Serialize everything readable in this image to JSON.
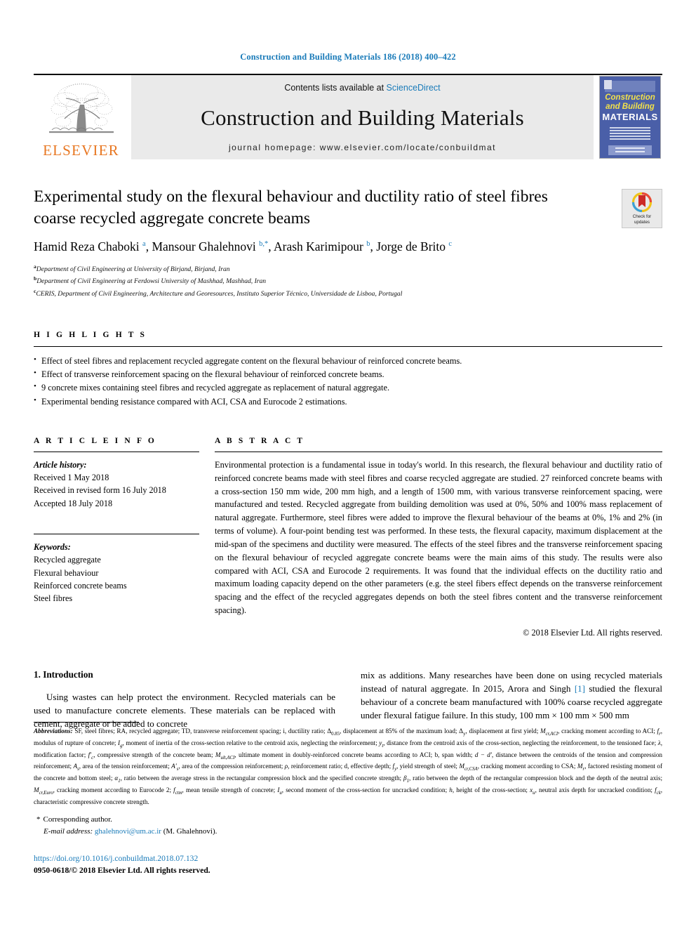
{
  "running_head": "Construction and Building Materials 186 (2018) 400–422",
  "masthead": {
    "publisher": "ELSEVIER",
    "contents_prefix": "Contents lists available at ",
    "sciencedirect": "ScienceDirect",
    "journal_title": "Construction and Building Materials",
    "homepage": "journal homepage: www.elsevier.com/locate/conbuildmat",
    "cover": {
      "line1": "Construction",
      "line2": "and Building",
      "line3": "MATERIALS"
    }
  },
  "article": {
    "title": "Experimental study on the flexural behaviour and ductility ratio of steel fibres coarse recycled aggregate concrete beams",
    "authors_html": "Hamid Reza Chaboki <sup>a</sup>, Mansour Ghalehnovi <sup>b,</sup><sup class=\"star\">*</sup>, Arash Karimipour <sup>b</sup>, Jorge de Brito <sup>c</sup>",
    "affiliations": [
      {
        "marker": "a",
        "text": "Department of Civil Engineering at University of Birjand, Birjand, Iran"
      },
      {
        "marker": "b",
        "text": "Department of Civil Engineering at Ferdowsi University of Mashhad, Mashhad, Iran"
      },
      {
        "marker": "c",
        "text": "CERIS, Department of Civil Engineering, Architecture and Georesources, Instituto Superior Técnico, Universidade de Lisboa, Portugal"
      }
    ],
    "crossmark_line1": "Check for",
    "crossmark_line2": "updates"
  },
  "highlights": {
    "heading": "H I G H L I G H T S",
    "items": [
      "Effect of steel fibres and replacement recycled aggregate content on the flexural behaviour of reinforced concrete beams.",
      "Effect of transverse reinforcement spacing on the flexural behaviour of reinforced concrete beams.",
      "9 concrete mixes containing steel fibres and recycled aggregate as replacement of natural aggregate.",
      "Experimental bending resistance compared with ACI, CSA and Eurocode 2 estimations."
    ]
  },
  "article_info": {
    "heading": "A R T I C L E   I N F O",
    "history_label": "Article history:",
    "history": [
      "Received 1 May 2018",
      "Received in revised form 16 July 2018",
      "Accepted 18 July 2018"
    ],
    "keywords_label": "Keywords:",
    "keywords": [
      "Recycled aggregate",
      "Flexural behaviour",
      "Reinforced concrete beams",
      "Steel fibres"
    ]
  },
  "abstract": {
    "heading": "A B S T R A C T",
    "text": "Environmental protection is a fundamental issue in today's world. In this research, the flexural behaviour and ductility ratio of reinforced concrete beams made with steel fibres and coarse recycled aggregate are studied. 27 reinforced concrete beams with a cross-section 150 mm wide, 200 mm high, and a length of 1500 mm, with various transverse reinforcement spacing, were manufactured and tested. Recycled aggregate from building demolition was used at 0%, 50% and 100% mass replacement of natural aggregate. Furthermore, steel fibres were added to improve the flexural behaviour of the beams at 0%, 1% and 2% (in terms of volume). A four-point bending test was performed. In these tests, the flexural capacity, maximum displacement at the mid-span of the specimens and ductility were measured. The effects of the steel fibres and the transverse reinforcement spacing on the flexural behaviour of recycled aggregate concrete beams were the main aims of this study. The results were also compared with ACI, CSA and Eurocode 2 requirements. It was found that the individual effects on the ductility ratio and maximum loading capacity depend on the other parameters (e.g. the steel fibers effect depends on the transverse reinforcement spacing and the effect of the recycled aggregates depends on both the steel fibres content and the transverse reinforcement spacing).",
    "copyright": "© 2018 Elsevier Ltd. All rights reserved."
  },
  "introduction": {
    "heading": "1. Introduction",
    "left_paragraph": "Using wastes can help protect the environment. Recycled materials can be used to manufacture concrete elements. These materials can be replaced with cement, aggregate or be added to concrete",
    "right_paragraph_pre": "mix as additions. Many researches have been done on using recycled materials instead of natural aggregate. In 2015, Arora and Singh ",
    "right_reference": "[1]",
    "right_paragraph_post": " studied the flexural behaviour of a concrete beam manufactured with 100% coarse recycled aggregate under flexural fatigue failure. In this study, 100 mm × 100 mm × 500 mm"
  },
  "footnotes": {
    "abbreviations_label": "Abbreviations:",
    "abbreviations_html": "SF, steel fibres; RA, recycled aggregate; TD, transverse reinforcement spacing; i, ductility ratio; &Delta;<sub>0.85</sub>, displacement at 85% of the maximum load; &Delta;<sub>y</sub>, displacement at first yield; <i>M<sub>cr,ACI</sub></i>, cracking moment according to ACI; <i>f<sub>r</sub></i>, modulus of rupture of concrete; <i>I<sub>g</sub></i>, moment of inertia of the cross-section relative to the centroid axis, neglecting the reinforcement; <i>y<sub>t</sub></i>, distance from the centroid axis of the cross-section, neglecting the reinforcement, to the tensioned face; <i>&lambda;</i>, modification factor; <i>f′<sub>c</sub></i>, compressive strength of the concrete beam; <i>M<sub>ult,ACI</sub></i>, ultimate moment in doubly-reinforced concrete beams according to ACI; b, span width; <i>d &minus; d′</i>, distance between the centroids of the tension and compression reinforcement; <i>A<sub>s</sub></i>, area of the tension reinforcement; <i>A′<sub>s</sub></i>, area of the compression reinforcement; <i>&rho;</i>, reinforcement ratio; d, effective depth; <i>f<sub>y</sub></i>, yield strength of steel; <i>M<sub>cr,CSA</sub></i>, cracking moment according to CSA; <i>M<sub>r</sub></i>, factored resisting moment of the concrete and bottom steel; <i>&alpha;<sub>1</sub></i>, ratio between the average stress in the rectangular compression block and the specified concrete strength; <i>&beta;<sub>1</sub></i>, ratio between the depth of the rectangular compression block and the depth of the neutral axis; <i>M<sub>cr,Euro</sub></i>, cracking moment according to Eurocode 2; <i>f<sub>ctm</sub></i>, mean tensile strength of concrete; <i>I<sub>u</sub></i>, second moment of the cross-section for uncracked condition; <i>h</i>, height of the cross-section; <i>x<sub>u</sub></i>, neutral axis depth for uncracked condition; <i>f<sub>ck</sub></i>, characteristic compressive concrete strength.",
    "corresponding_author": "Corresponding author.",
    "email_label": "E-mail address:",
    "email": "ghalehnovi@um.ac.ir",
    "email_owner": "(M. Ghalehnovi).",
    "doi": "https://doi.org/10.1016/j.conbuildmat.2018.07.132",
    "issn_line": "0950-0618/© 2018 Elsevier Ltd. All rights reserved."
  },
  "colors": {
    "link_blue": "#1a7bb9",
    "elsevier_orange": "#E87722",
    "masthead_grey": "#eaeaea",
    "cover_blue": "#4a5fa8"
  }
}
